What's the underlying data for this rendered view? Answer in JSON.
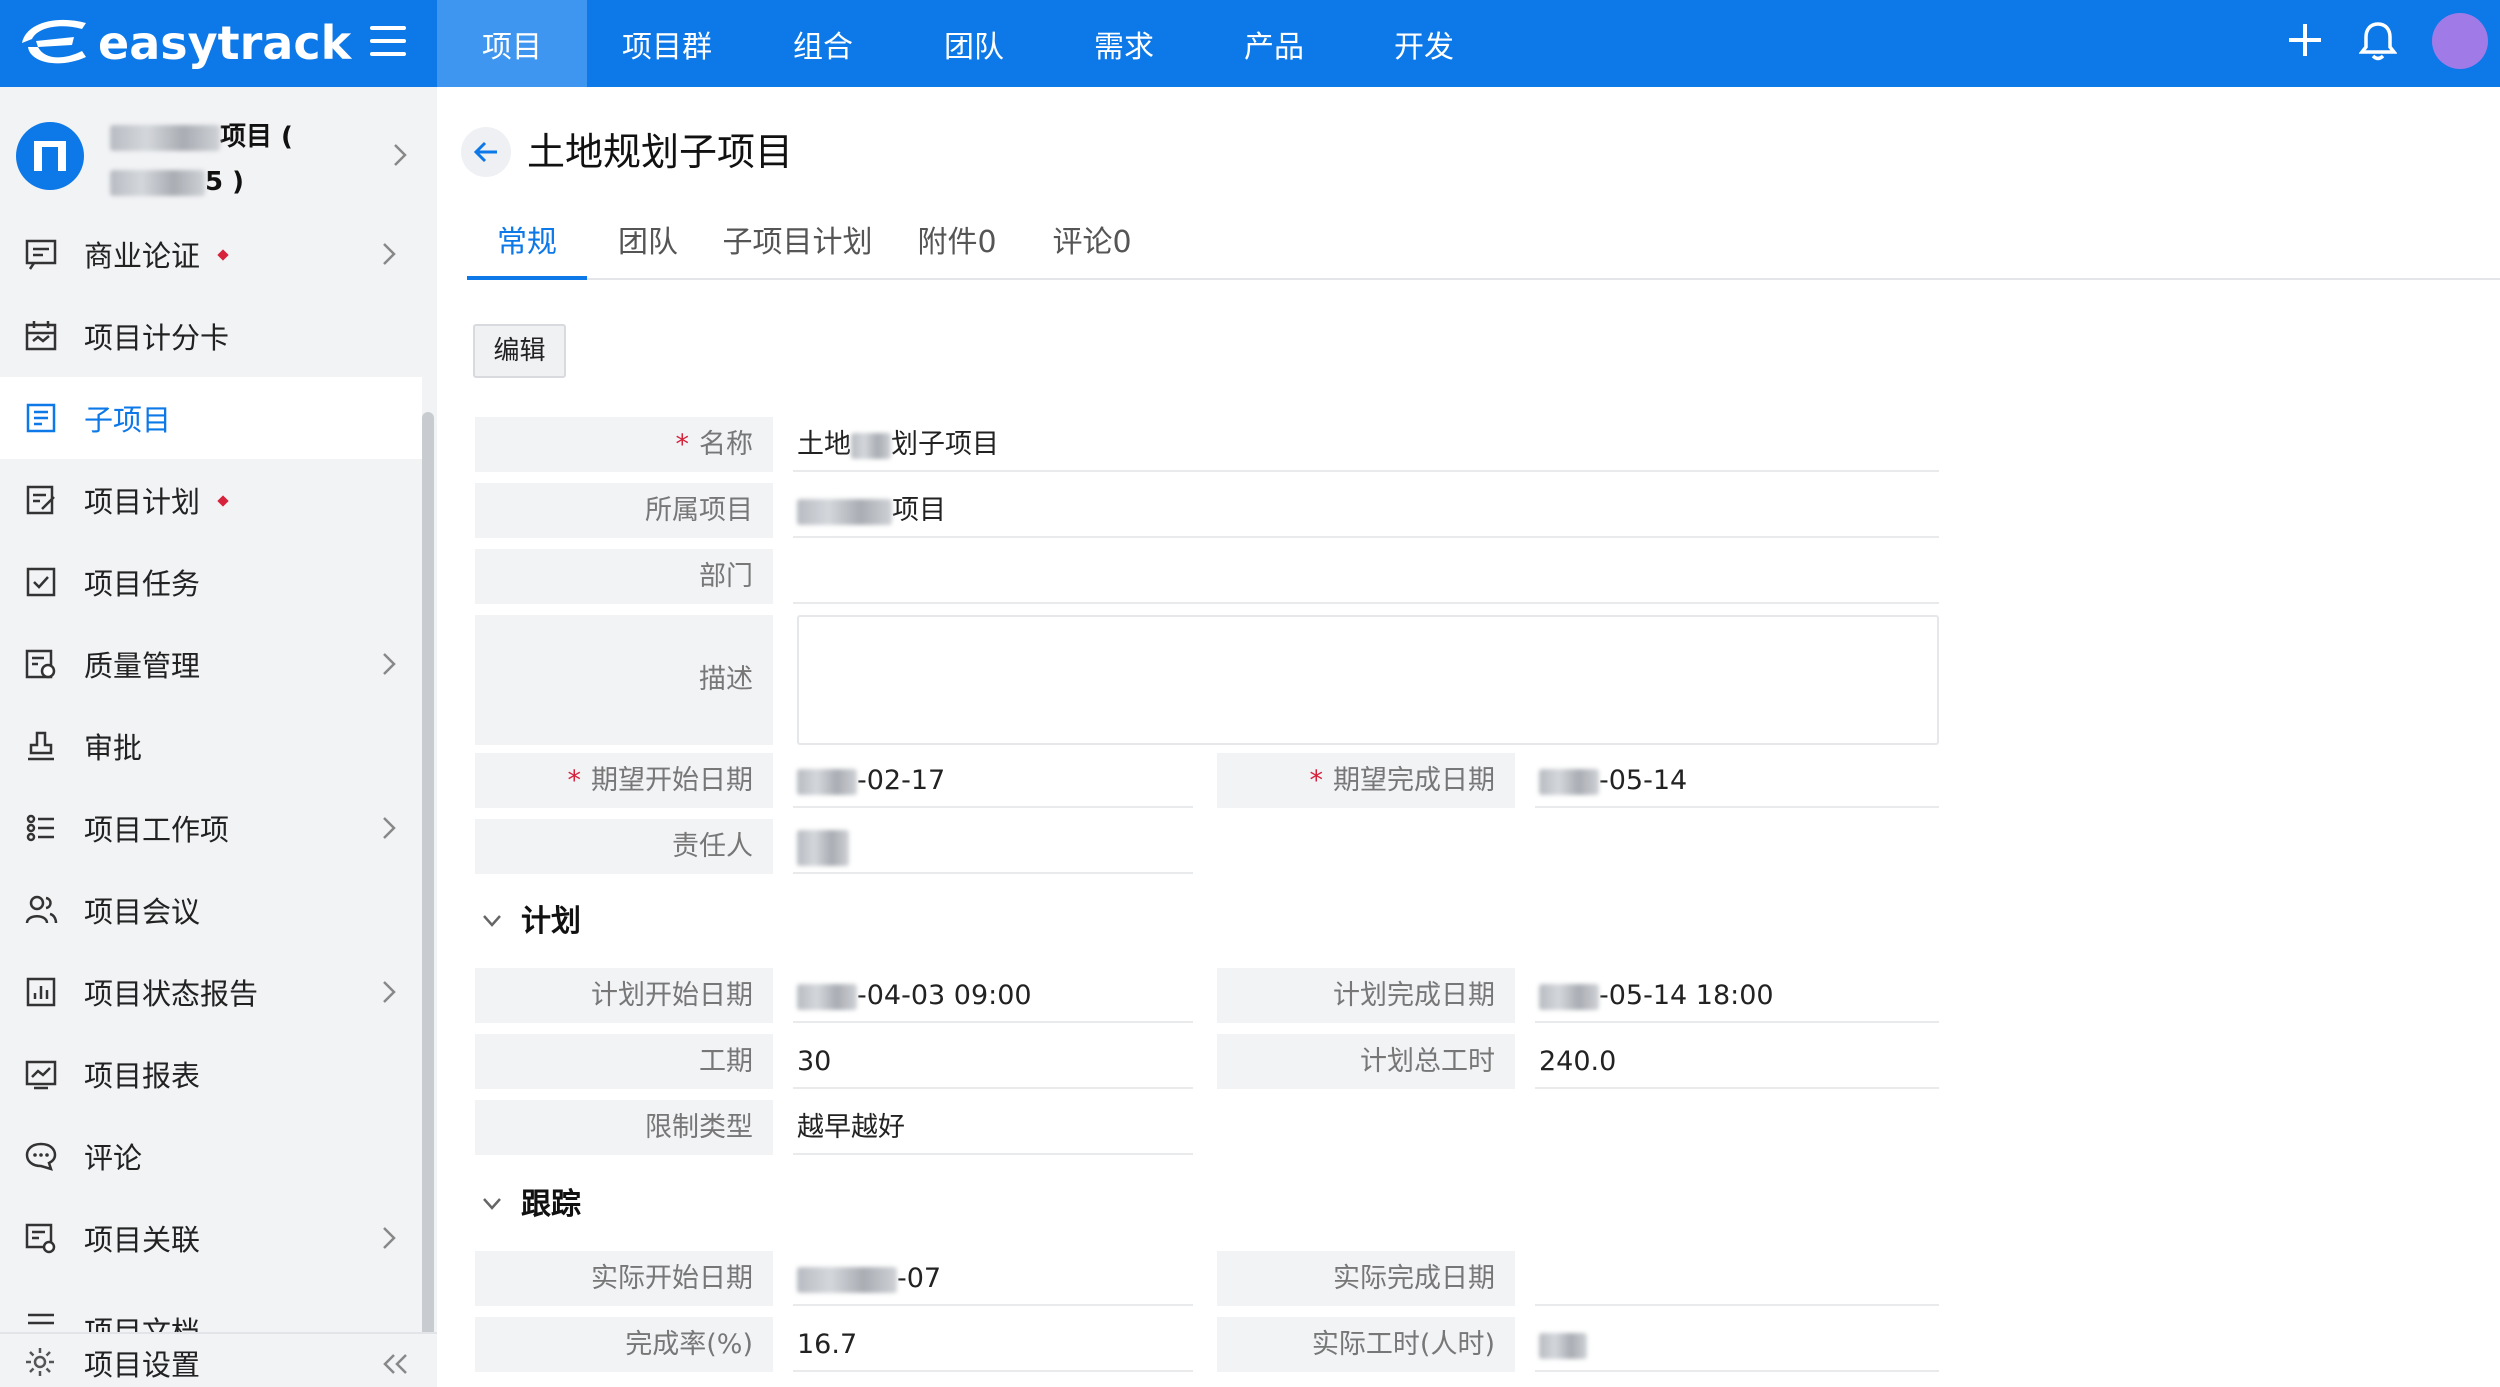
{
  "app": {
    "logo_text": "easytrack",
    "nav": [
      "项目",
      "项目群",
      "组合",
      "团队",
      "需求",
      "产品",
      "开发"
    ],
    "active_nav": "项目"
  },
  "sidebar": {
    "project_name_line1": "项目 (",
    "project_name_line2": "5 )",
    "items": [
      {
        "label": "商业论证",
        "dot": true,
        "chevron": true
      },
      {
        "label": "项目计分卡",
        "dot": false,
        "chevron": false
      },
      {
        "label": "子项目",
        "dot": false,
        "chevron": false,
        "active": true
      },
      {
        "label": "项目计划",
        "dot": true,
        "chevron": false
      },
      {
        "label": "项目任务",
        "dot": false,
        "chevron": false
      },
      {
        "label": "质量管理",
        "dot": false,
        "chevron": true
      },
      {
        "label": "审批",
        "dot": false,
        "chevron": false
      },
      {
        "label": "项目工作项",
        "dot": false,
        "chevron": true
      },
      {
        "label": "项目会议",
        "dot": false,
        "chevron": false
      },
      {
        "label": "项目状态报告",
        "dot": false,
        "chevron": true
      },
      {
        "label": "项目报表",
        "dot": false,
        "chevron": false
      },
      {
        "label": "评论",
        "dot": false,
        "chevron": false
      },
      {
        "label": "项目关联",
        "dot": false,
        "chevron": true
      },
      {
        "label": "项目文档",
        "dot": false,
        "chevron": false
      }
    ],
    "footer_label": "项目设置"
  },
  "page": {
    "title": "土地规划子项目",
    "tabs": [
      "常规",
      "团队",
      "子项目计划",
      "附件0",
      "评论0"
    ],
    "edit_label": "编辑"
  },
  "form": {
    "name_label": "名称",
    "name_value_a": "土地",
    "name_value_b": "划子项目",
    "parent_label": "所属项目",
    "parent_value": "项目",
    "dept_label": "部门",
    "desc_label": "描述",
    "exp_start_label": "期望开始日期",
    "exp_start_value": "-02-17",
    "exp_end_label": "期望完成日期",
    "exp_end_value": "-05-14",
    "owner_label": "责任人"
  },
  "plan": {
    "section": "计划",
    "start_label": "计划开始日期",
    "start_value": "-04-03 09:00",
    "end_label": "计划完成日期",
    "end_value": "-05-14 18:00",
    "duration_label": "工期",
    "duration_value": "30",
    "hours_label": "计划总工时",
    "hours_value": "240.0",
    "constraint_label": "限制类型",
    "constraint_value": "越早越好"
  },
  "track": {
    "section": "跟踪",
    "actual_start_label": "实际开始日期",
    "actual_start_value": "-07",
    "actual_end_label": "实际完成日期",
    "rate_label": "完成率(%)",
    "rate_value": "16.7",
    "actual_hours_label": "实际工时(人时)"
  }
}
